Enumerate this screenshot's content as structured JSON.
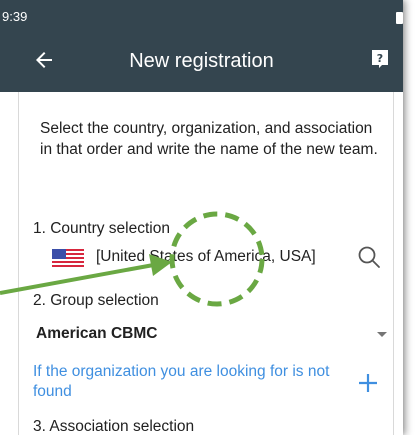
{
  "status_bar": {
    "time": "9:39"
  },
  "app_bar": {
    "title": "New registration",
    "back_icon": "arrow-left-icon",
    "help_icon": "help-icon"
  },
  "form": {
    "instructions": "Select the country, organization, and association in that order and write the name of the new team.",
    "country": {
      "label": "1. Country selection",
      "value": "[United States of America, USA]",
      "flag_icon": "us-flag-icon",
      "search_icon": "search-icon"
    },
    "group": {
      "label": "2. Group selection",
      "value": "American CBMC"
    },
    "not_found_link": "If the organization you are looking for is not found",
    "association": {
      "label": "3. Association selection"
    }
  },
  "colors": {
    "app_bar": "#34454f",
    "link": "#3f8fe0",
    "highlight": "#6aa843"
  }
}
